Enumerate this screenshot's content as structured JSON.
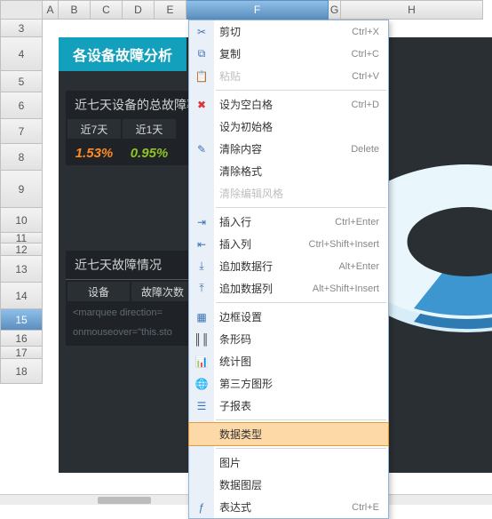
{
  "columns": {
    "A": "A",
    "B": "B",
    "C": "C",
    "D": "D",
    "E": "E",
    "F": "F",
    "G": "G",
    "H": "H"
  },
  "rows": {
    "3": "3",
    "4": "4",
    "5": "5",
    "6": "6",
    "7": "7",
    "8": "8",
    "9": "9",
    "10": "10",
    "11": "11",
    "12": "12",
    "13": "13",
    "14": "14",
    "15": "15",
    "16": "16",
    "17": "17",
    "18": "18"
  },
  "selected_row": "15",
  "selected_col": "F",
  "report": {
    "title": "各设备故障分析",
    "block1_header": "近七天设备的总故障率",
    "col_last7": "近7天",
    "col_last1": "近1天",
    "val_last7": "1.53%",
    "val_last1": "0.95%",
    "block2_header": "近七天故障情况",
    "col_device": "设备",
    "col_faultcnt": "故障次数",
    "faint1": "<marquee direction=",
    "faint2": "onmouseover=\"this.sto"
  },
  "menu": {
    "cut": {
      "label": "剪切",
      "shortcut": "Ctrl+X"
    },
    "copy": {
      "label": "复制",
      "shortcut": "Ctrl+C"
    },
    "paste": {
      "label": "粘贴",
      "shortcut": "Ctrl+V"
    },
    "setblank": {
      "label": "设为空白格",
      "shortcut": "Ctrl+D"
    },
    "setinit": {
      "label": "设为初始格"
    },
    "clearcont": {
      "label": "清除内容",
      "shortcut": "Delete"
    },
    "clearfmt": {
      "label": "清除格式"
    },
    "cleareditst": {
      "label": "清除编辑风格"
    },
    "insrow": {
      "label": "插入行",
      "shortcut": "Ctrl+Enter"
    },
    "inscol": {
      "label": "插入列",
      "shortcut": "Ctrl+Shift+Insert"
    },
    "addrow": {
      "label": "追加数据行",
      "shortcut": "Alt+Enter"
    },
    "addcol": {
      "label": "追加数据列",
      "shortcut": "Alt+Shift+Insert"
    },
    "border": {
      "label": "边框设置"
    },
    "barcode": {
      "label": "条形码"
    },
    "chart": {
      "label": "统计图"
    },
    "thirdparty": {
      "label": "第三方图形"
    },
    "subreport": {
      "label": "子报表"
    },
    "datatype": {
      "label": "数据类型"
    },
    "image": {
      "label": "图片"
    },
    "datalayer": {
      "label": "数据图层"
    },
    "expr": {
      "label": "表达式",
      "shortcut": "Ctrl+E"
    }
  }
}
